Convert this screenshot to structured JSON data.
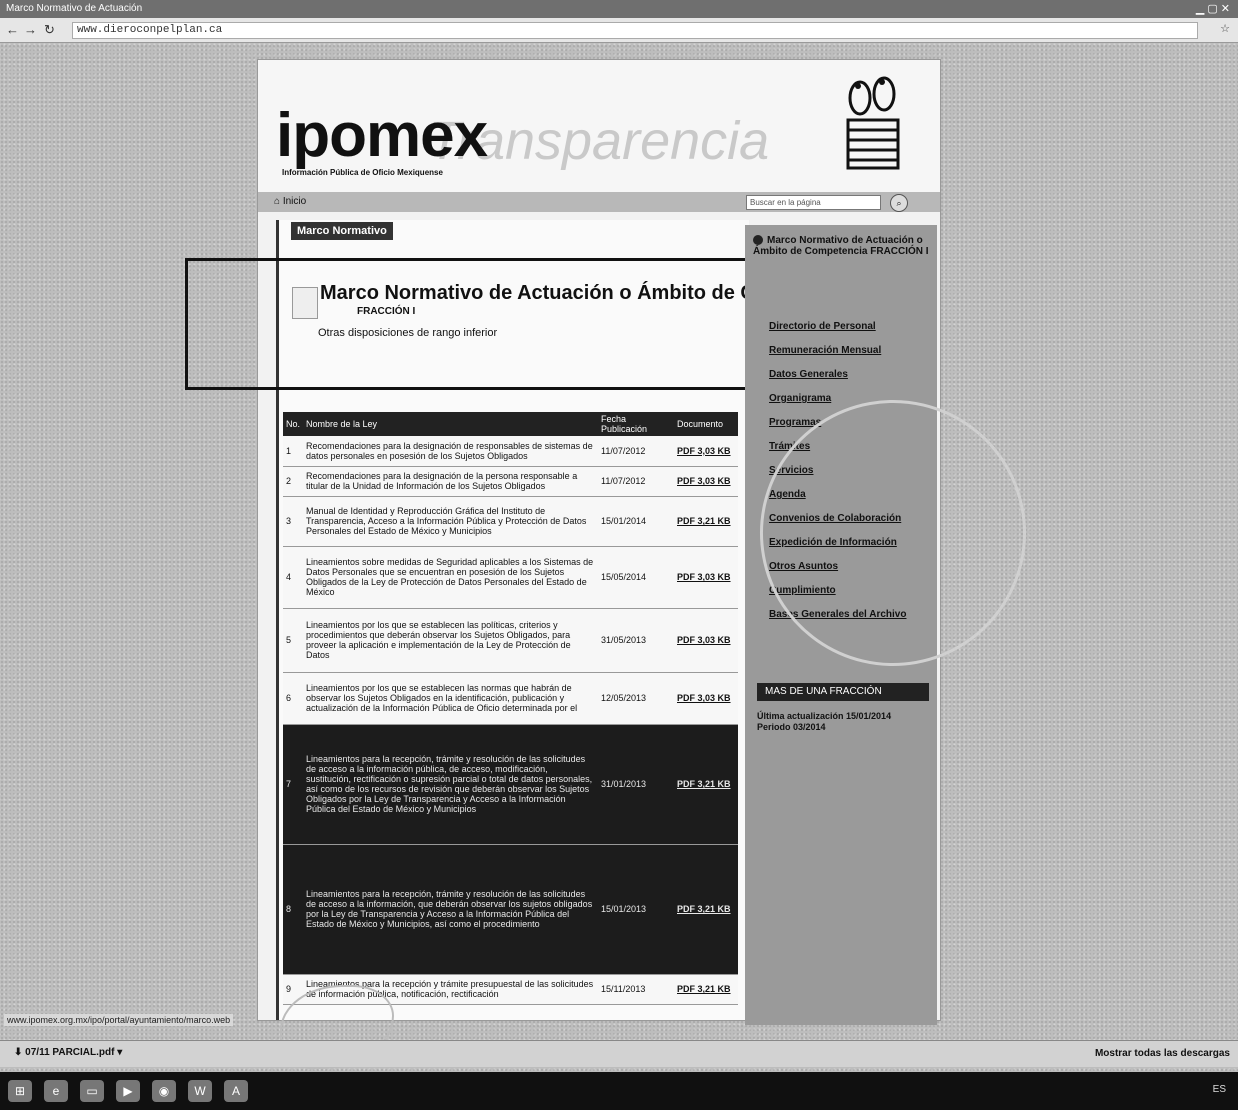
{
  "browser": {
    "window_title": "Marco Normativo de Actuación",
    "url": "www.dieroconpelplan.ca",
    "back_icon": "back-arrow-icon",
    "forward_icon": "forward-arrow-icon",
    "reload_icon": "reload-icon"
  },
  "site": {
    "logo": "ipomex",
    "logo_tagline": "Información Pública de Oficio Mexiquense",
    "menu_home": "Inicio",
    "search_placeholder": "Buscar en la página",
    "section_badge": "Marco Normativo"
  },
  "document": {
    "title": "Marco Normativo de Actuación o Ámbito de Competencia",
    "fraction": "FRACCIÓN I",
    "subtitle": "Otras disposiciones de rango inferior"
  },
  "table": {
    "headers": [
      "No.",
      "Nombre de la Ley",
      "Fecha Publicación",
      "Documento"
    ],
    "rows": [
      {
        "n": "1",
        "name": "Recomendaciones para la designación de responsables de sistemas de datos personales en posesión de los Sujetos Obligados",
        "date": "11/07/2012",
        "link": "PDF 3,03 KB"
      },
      {
        "n": "2",
        "name": "Recomendaciones para la designación de la persona responsable a titular de la Unidad de Información de los Sujetos Obligados",
        "date": "11/07/2012",
        "link": "PDF 3,03 KB"
      },
      {
        "n": "3",
        "name": "Manual de Identidad y Reproducción Gráfica del Instituto de Transparencia, Acceso a la Información Pública y Protección de Datos Personales del Estado de México y Municipios",
        "date": "15/01/2014",
        "link": "PDF 3,21 KB"
      },
      {
        "n": "4",
        "name": "Lineamientos sobre medidas de Seguridad aplicables a los Sistemas de Datos Personales que se encuentran en posesión de los Sujetos Obligados de la Ley de Protección de Datos Personales del Estado de México",
        "date": "15/05/2014",
        "link": "PDF 3,03 KB"
      },
      {
        "n": "5",
        "name": "Lineamientos por los que se establecen las políticas, criterios y procedimientos que deberán observar los Sujetos Obligados, para proveer la aplicación e implementación de la Ley de Protección de Datos",
        "date": "31/05/2013",
        "link": "PDF 3,03 KB"
      },
      {
        "n": "6",
        "name": "Lineamientos por los que se establecen las normas que habrán de observar los Sujetos Obligados en la identificación, publicación y actualización de la Información Pública de Oficio determinada por el",
        "date": "12/05/2013",
        "link": "PDF 3,03 KB"
      },
      {
        "n": "7",
        "name": "Lineamientos para la recepción, trámite y resolución de las solicitudes de acceso a la información pública, de acceso, modificación, sustitución, rectificación o supresión parcial o total de datos personales, así como de los recursos de revisión que deberán observar los Sujetos Obligados por la Ley de Transparencia y Acceso a la Información Pública del Estado de México y Municipios",
        "date": "31/01/2013",
        "link": "PDF 3,21 KB"
      },
      {
        "n": "8",
        "name": "Lineamientos para la recepción, trámite y resolución de las solicitudes de acceso a la información, que deberán observar los sujetos obligados por la Ley de Transparencia y Acceso a la Información Pública del Estado de México y Municipios, así como el procedimiento",
        "date": "15/01/2013",
        "link": "PDF 3,21 KB"
      },
      {
        "n": "9",
        "name": "Lineamientos para la recepción y trámite presupuestal de las solicitudes de información pública, notificación, rectificación",
        "date": "15/11/2013",
        "link": "PDF 3,21 KB"
      }
    ]
  },
  "sidebar": {
    "active": "Marco Normativo de Actuación o Ámbito de Competencia FRACCIÓN I",
    "items": [
      "Directorio de Personal",
      "Remuneración Mensual",
      "Datos Generales",
      "Organigrama",
      "Programas",
      "Trámites",
      "Servicios",
      "Agenda",
      "Convenios de Colaboración",
      "Expedición de Información",
      "Otros Asuntos",
      "Cumplimiento",
      "Bases Generales del Archivo"
    ],
    "panel_header": "MAS DE UNA FRACCIÓN",
    "panel_text": "Última actualización 15/01/2014 Periodo 03/2014"
  },
  "status_url": "www.ipomex.org.mx/ipo/portal/ayuntamiento/marco.web",
  "downloads": {
    "file": "07/11 PARCIAL.pdf",
    "show_all": "Mostrar todas las descargas"
  },
  "taskbar": {
    "icons": [
      "windows-start-icon",
      "ie-icon",
      "folder-icon",
      "media-icon",
      "chrome-icon",
      "word-icon",
      "pdf-icon"
    ],
    "tray": "ES"
  }
}
